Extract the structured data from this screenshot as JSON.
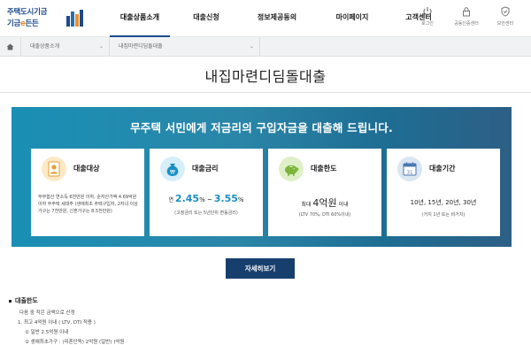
{
  "header": {
    "logo_line1": "주택도시기금",
    "logo_line2_a": "기금",
    "logo_line2_b": "e",
    "logo_line2_c": "든든",
    "menu": [
      {
        "label": "대출상품소개",
        "active": true
      },
      {
        "label": "대출신청",
        "active": false
      },
      {
        "label": "정보제공동의",
        "active": false
      },
      {
        "label": "마이페이지",
        "active": false
      },
      {
        "label": "고객센터",
        "active": false
      }
    ],
    "util": [
      {
        "label": "로그인",
        "icon": "power-icon"
      },
      {
        "label": "공동인증센터",
        "icon": "lock-icon"
      },
      {
        "label": "보안센터",
        "icon": "shield-icon"
      }
    ]
  },
  "breadcrumb": {
    "home_icon": "home-icon",
    "level1": "대출상품소개",
    "level2": "내집마련디딤돌대출"
  },
  "page": {
    "title": "내집마련디딤돌대출"
  },
  "banner": {
    "headline": "무주택 서민에게 저금리의 구입자금을 대출해 드립니다.",
    "cards": [
      {
        "title": "대출대상",
        "icon": "person-id-icon",
        "desc": "부부합산 연소득 6천만원 이하, 순자산가액 4.69억원 이하 무주택 세대주 (생애최초 주택구입자, 2자녀 이상 가구는 7천만원, 신혼가구는 8.5천만원)"
      },
      {
        "title": "대출금리",
        "icon": "money-bag-icon",
        "rate_prefix": "연",
        "rate_low": "2.45",
        "rate_sep": "% ~",
        "rate_high": "3.55",
        "rate_unit": "%",
        "sub": "(고정금리 또는 5년단위 변동금리)"
      },
      {
        "title": "대출한도",
        "icon": "piggy-bank-icon",
        "limit_prefix": "최대",
        "limit_num": "4억원",
        "limit_suffix": "이내",
        "sub": "(LTV 70%, DTI 60%이내)"
      },
      {
        "title": "대출기간",
        "icon": "calendar-icon",
        "calendar_day": "31",
        "periods": "10년, 15년, 20년, 30년",
        "sub": "(거치 1년 또는 비거치)"
      }
    ]
  },
  "more_button": "자세히보기",
  "section": {
    "title": "대출한도",
    "lines": [
      "다음 중 작은 금액으로 산정",
      "1. 최고 4억원 이내 ( LTV, DTI 적용 )",
      "① 일반 2.5억원 이내",
      "② 생애최초가구 : (미혼단독) 2억원 (일반) )억원"
    ]
  },
  "colors": {
    "brand_navy": "#1d4a8c",
    "banner_teal": "#1a8fb5",
    "button_navy": "#173f6e",
    "rate_accent": "#1c8fc4"
  }
}
